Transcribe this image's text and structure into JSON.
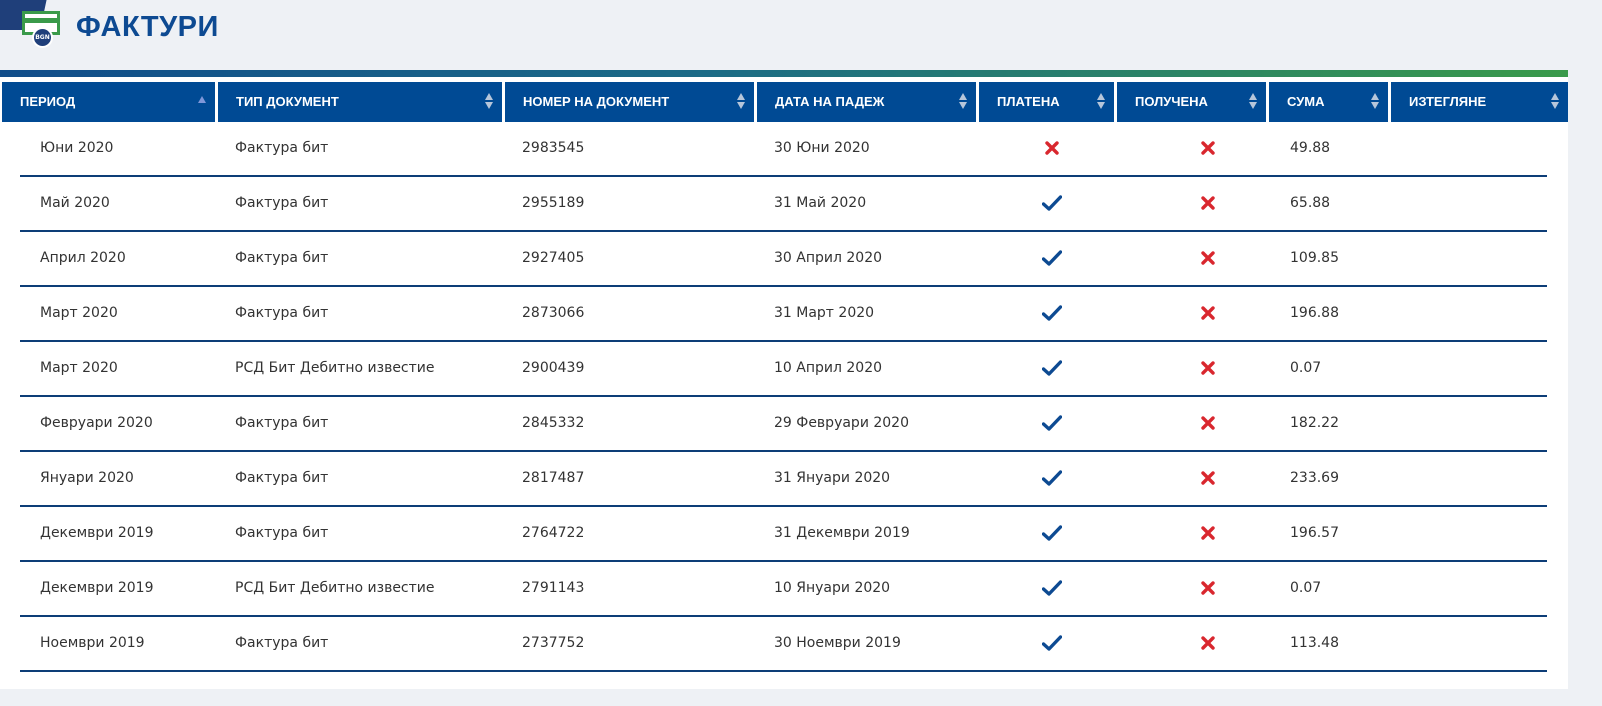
{
  "page": {
    "title": "ФАКТУРИ",
    "icon_badge": "BGN"
  },
  "colors": {
    "header_bg": "#004a94",
    "title": "#0d4a92",
    "check": "#0d4a92",
    "cross": "#d9272e",
    "accent_green": "#3a9a4a"
  },
  "table": {
    "columns": [
      {
        "label": "ПЕРИОД",
        "width": 213,
        "sort": "asc"
      },
      {
        "label": "ТИП ДОКУМЕНТ",
        "width": 284,
        "sort": "none"
      },
      {
        "label": "НОМЕР НА ДОКУМЕНТ",
        "width": 249,
        "sort": "none"
      },
      {
        "label": "ДАТА НА ПАДЕЖ",
        "width": 219,
        "sort": "none"
      },
      {
        "label": "ПЛАТЕНА",
        "width": 135,
        "sort": "none"
      },
      {
        "label": "ПОЛУЧЕНА",
        "width": 149,
        "sort": "none"
      },
      {
        "label": "СУМА",
        "width": 119,
        "sort": "none"
      },
      {
        "label": "ИЗТЕГЛЯНЕ",
        "width": 177,
        "sort": "none"
      }
    ],
    "rows": [
      {
        "period": "Юни 2020",
        "type": "Фактура бит",
        "number": "2983545",
        "due": "30 Юни 2020",
        "paid": false,
        "received": false,
        "amount": "49.88"
      },
      {
        "period": "Май 2020",
        "type": "Фактура бит",
        "number": "2955189",
        "due": "31 Май 2020",
        "paid": true,
        "received": false,
        "amount": "65.88"
      },
      {
        "period": "Април 2020",
        "type": "Фактура бит",
        "number": "2927405",
        "due": "30 Април 2020",
        "paid": true,
        "received": false,
        "amount": "109.85"
      },
      {
        "period": "Март 2020",
        "type": "Фактура бит",
        "number": "2873066",
        "due": "31 Март 2020",
        "paid": true,
        "received": false,
        "amount": "196.88"
      },
      {
        "period": "Март 2020",
        "type": "РСД Бит Дебитно известие",
        "number": "2900439",
        "due": "10 Април 2020",
        "paid": true,
        "received": false,
        "amount": "0.07"
      },
      {
        "period": "Февруари 2020",
        "type": "Фактура бит",
        "number": "2845332",
        "due": "29 Февруари 2020",
        "paid": true,
        "received": false,
        "amount": "182.22"
      },
      {
        "period": "Януари 2020",
        "type": "Фактура бит",
        "number": "2817487",
        "due": "31 Януари 2020",
        "paid": true,
        "received": false,
        "amount": "233.69"
      },
      {
        "period": "Декември 2019",
        "type": "Фактура бит",
        "number": "2764722",
        "due": "31 Декември 2019",
        "paid": true,
        "received": false,
        "amount": "196.57"
      },
      {
        "period": "Декември 2019",
        "type": "РСД Бит Дебитно известие",
        "number": "2791143",
        "due": "10 Януари 2020",
        "paid": true,
        "received": false,
        "amount": "0.07"
      },
      {
        "period": "Ноември 2019",
        "type": "Фактура бит",
        "number": "2737752",
        "due": "30 Ноември 2019",
        "paid": true,
        "received": false,
        "amount": "113.48"
      }
    ]
  }
}
